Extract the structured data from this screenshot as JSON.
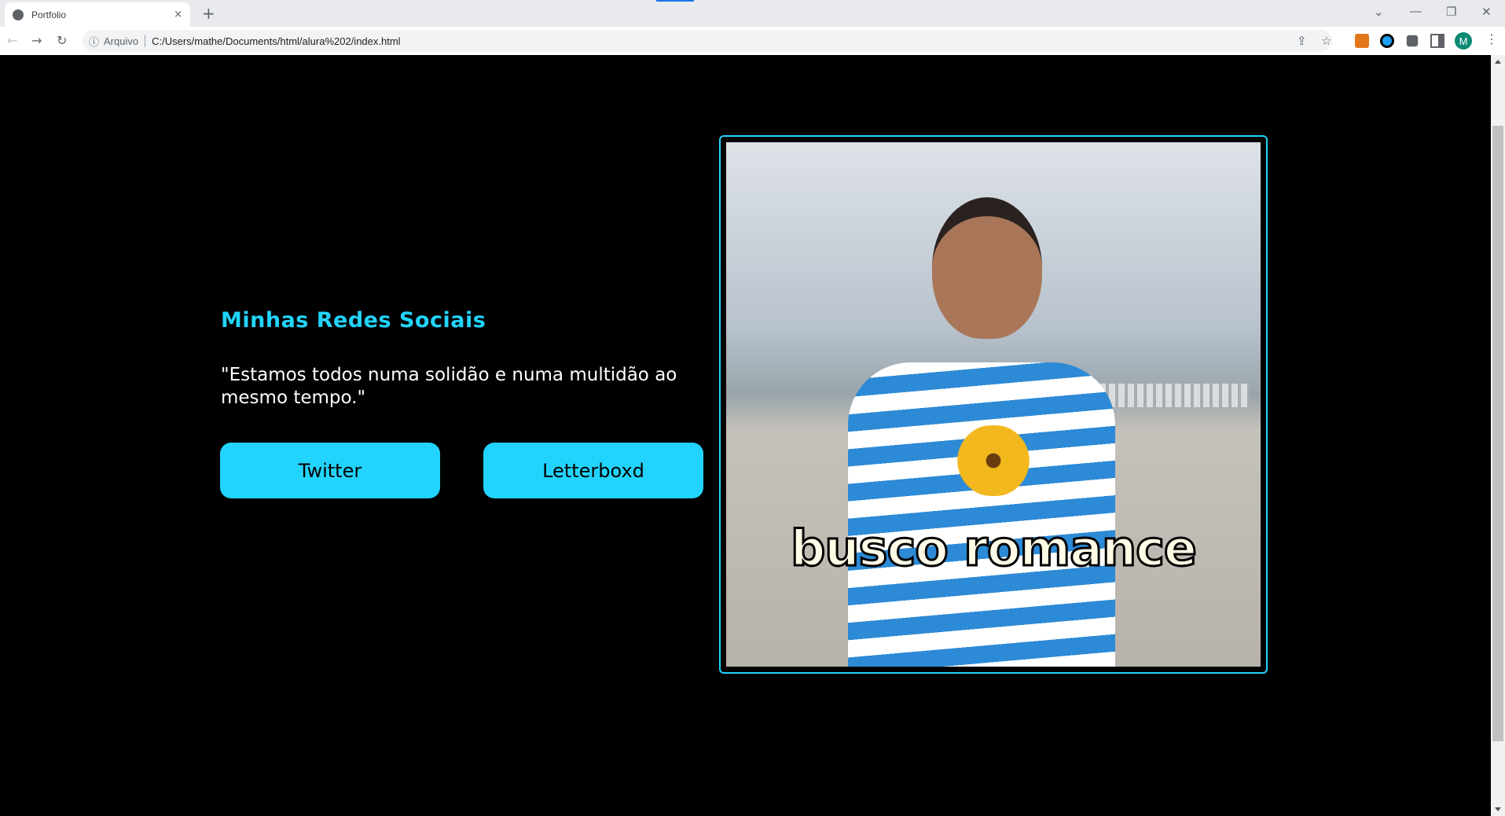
{
  "browser": {
    "tab_title": "Portfolio",
    "tab_close": "×",
    "new_tab": "+",
    "security_label": "Arquivo",
    "url": "C:/Users/mathe/Documents/html/alura%202/index.html",
    "profile_initial": "M"
  },
  "page": {
    "heading": "Minhas Redes Sociais",
    "quote": "\"Estamos todos numa solidão e numa multidão ao mesmo tempo.\"",
    "buttons": [
      {
        "label": "Twitter"
      },
      {
        "label": "Letterboxd"
      }
    ],
    "image_caption": "busco romance",
    "accent_color": "#22d4fd"
  }
}
